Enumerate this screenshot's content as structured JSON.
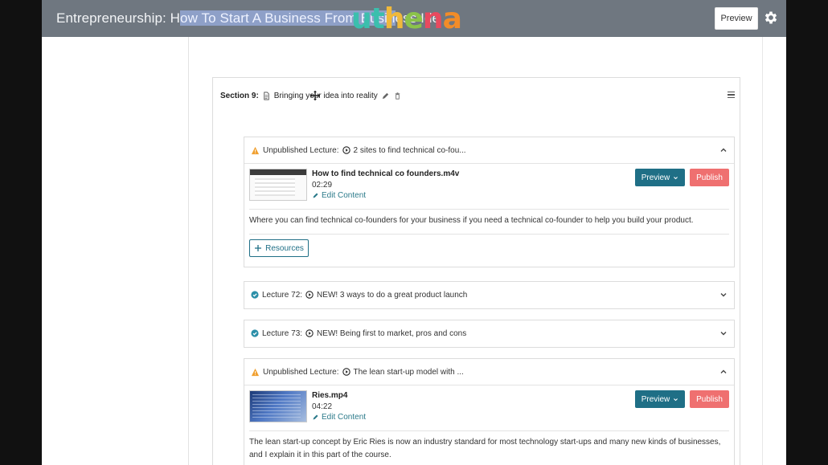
{
  "header": {
    "course_title_prefix": "Entrepreneurship: H",
    "course_title_selected": "ow To Start A Business From Busin",
    "course_title_suffix": "ess Ide",
    "logo": "uthena",
    "logo_colors": [
      "#3bbfad",
      "#3bbfad",
      "#f0b93b",
      "#8bc34a",
      "#e84a5f",
      "#f28c28"
    ],
    "preview_label": "Preview",
    "gear_icon": "gear-icon"
  },
  "section": {
    "number_label": "Section 9:",
    "title": "Bringing your idea into reality",
    "icons": [
      "file-icon",
      "pencil-icon",
      "trash-icon",
      "hamburger-icon"
    ]
  },
  "lectures": [
    {
      "status": "Unpublished Lecture:",
      "title": "2 sites to find technical co-fou...",
      "file": "How to find technical co founders.m4v",
      "duration": "02:29",
      "edit_label": "Edit Content",
      "preview_label": "Preview",
      "publish_label": "Publish",
      "description": "Where you can find technical co-founders for your business if you need a technical co-founder to help you build your product.",
      "resources_label": "Resources"
    },
    {
      "status": "Lecture 72:",
      "title": "NEW! 3 ways to do a great product launch"
    },
    {
      "status": "Lecture 73:",
      "title": "NEW! Being first to market, pros and cons"
    },
    {
      "status": "Unpublished Lecture:",
      "title": "The lean start-up model with ...",
      "file": "Ries.mp4",
      "duration": "04:22",
      "edit_label": "Edit Content",
      "preview_label": "Preview",
      "publish_label": "Publish",
      "description": "The lean start-up concept by Eric Ries is now an industry standard for most technology start-ups and many new kinds of businesses, and I explain it in this part of the course."
    }
  ],
  "colors": {
    "teal": "#1f6f86",
    "publish": "#ef7070",
    "warning": "#f0a030",
    "published": "#2b8fa8",
    "link": "#2b7a8a"
  }
}
